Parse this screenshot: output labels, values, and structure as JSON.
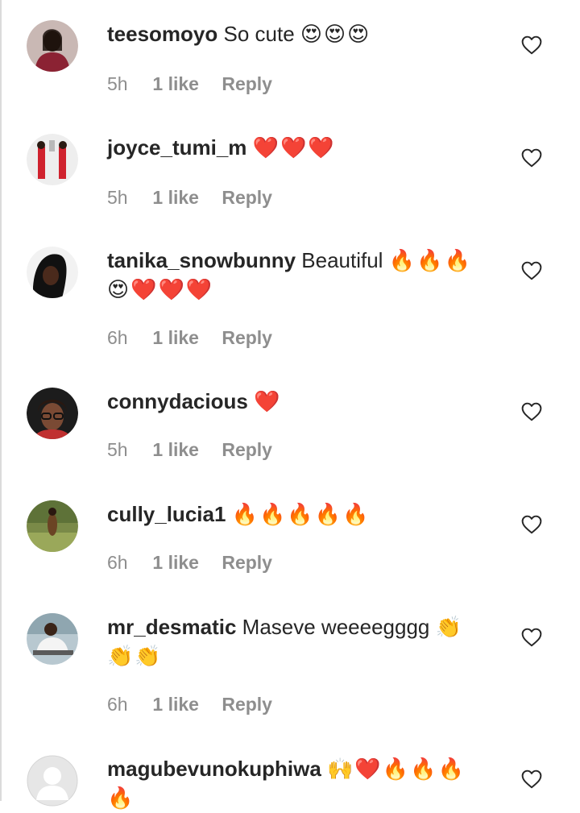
{
  "comments": [
    {
      "username": "teesomoyo",
      "text": "So cute",
      "emoji": "😍😍😍",
      "time": "5h",
      "likes": "1 like",
      "reply": "Reply",
      "avatar_icon": "user-avatar-photo"
    },
    {
      "username": "joyce_tumi_m",
      "text": "",
      "emoji": "❤️❤️❤️",
      "time": "5h",
      "likes": "1 like",
      "reply": "Reply",
      "avatar_icon": "user-avatar-photo"
    },
    {
      "username": "tanika_snowbunny",
      "text": "Beautiful",
      "emoji": "🔥🔥🔥 😍❤️❤️❤️",
      "time": "6h",
      "likes": "1 like",
      "reply": "Reply",
      "avatar_icon": "user-avatar-photo"
    },
    {
      "username": "connydacious",
      "text": "",
      "emoji": "❤️",
      "time": "5h",
      "likes": "1 like",
      "reply": "Reply",
      "avatar_icon": "user-avatar-photo"
    },
    {
      "username": "cully_lucia1",
      "text": "",
      "emoji": "🔥🔥🔥🔥🔥",
      "time": "6h",
      "likes": "1 like",
      "reply": "Reply",
      "avatar_icon": "user-avatar-photo"
    },
    {
      "username": "mr_desmatic",
      "text": "Maseve weeeegggg",
      "emoji": "👏👏👏",
      "time": "6h",
      "likes": "1 like",
      "reply": "Reply",
      "avatar_icon": "user-avatar-photo"
    },
    {
      "username": "magubevunokuphiwa",
      "text": "",
      "emoji": "🙌❤️🔥🔥🔥🔥",
      "time": "",
      "likes": "",
      "reply": "",
      "avatar_icon": "default-avatar-icon"
    }
  ],
  "colors": {
    "text": "#262626",
    "meta": "#8e8e8e",
    "divider": "#dbdbdb"
  },
  "icons": {
    "like": "heart-outline-icon"
  }
}
